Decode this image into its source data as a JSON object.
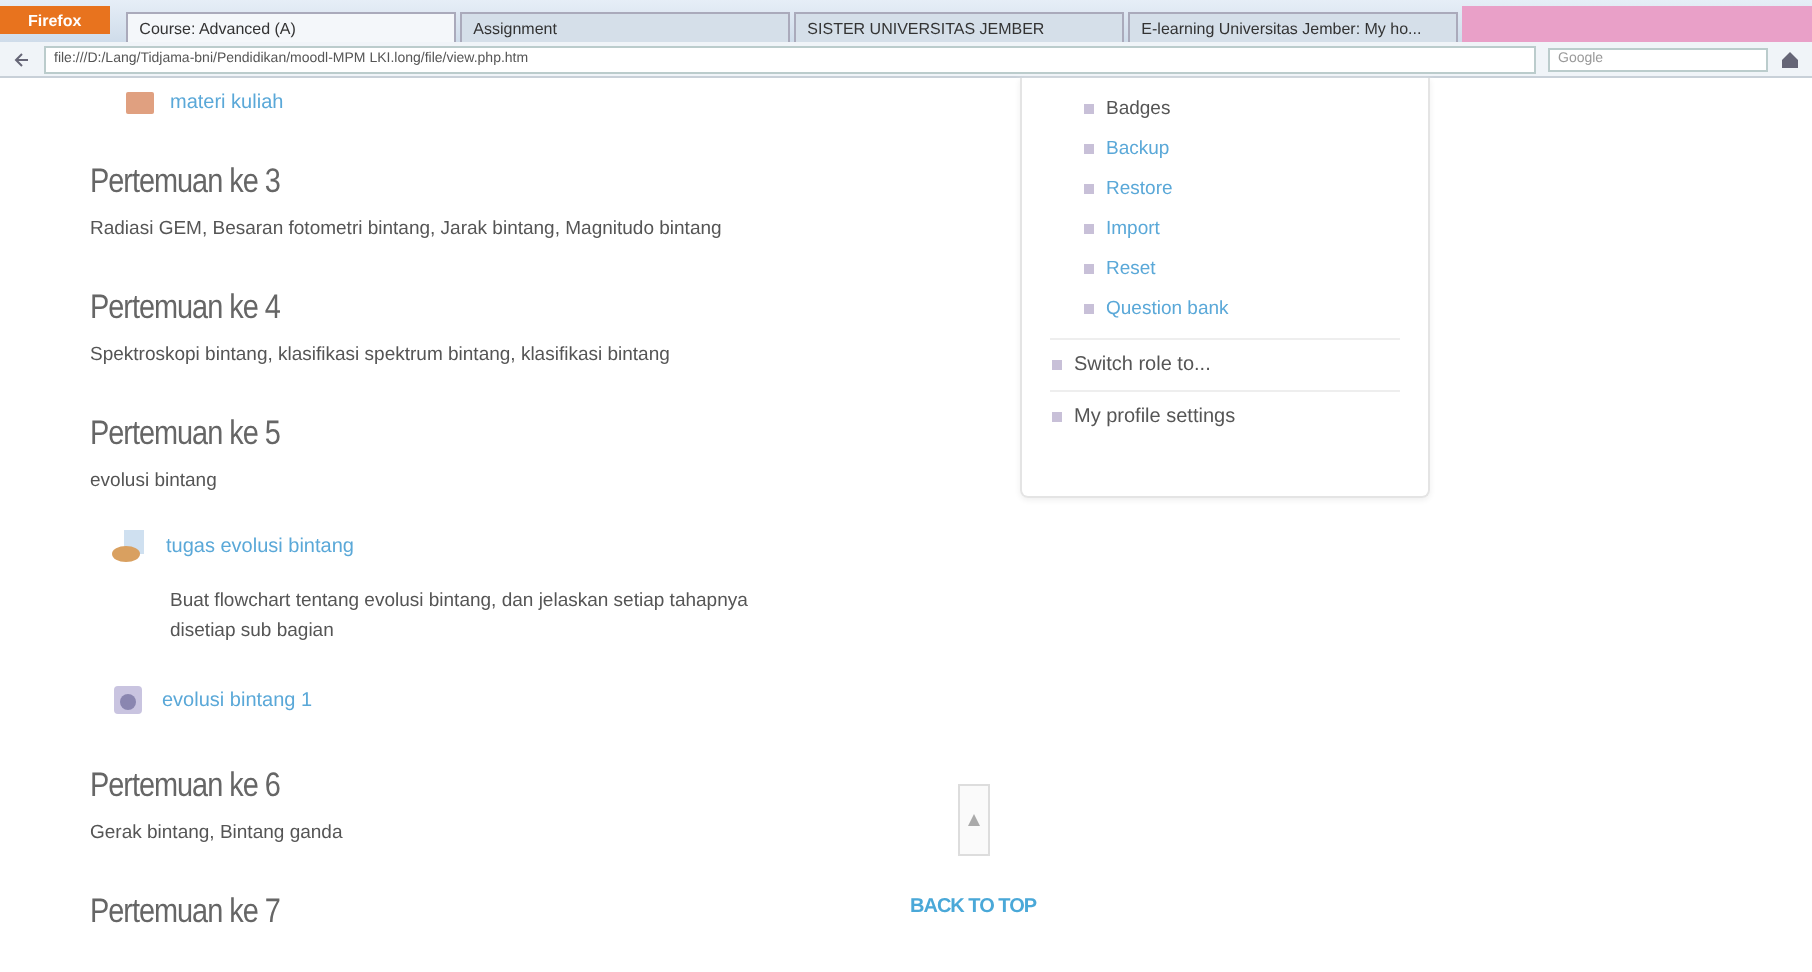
{
  "browser": {
    "menu_button": "Firefox",
    "tabs": [
      {
        "label": "Course: Advanced (A)",
        "selected": true
      },
      {
        "label": "Assignment",
        "selected": false
      },
      {
        "label": "SISTER UNIVERSITAS JEMBER",
        "selected": false
      },
      {
        "label": "E-learning Universitas Jember: My ho...",
        "selected": false
      }
    ],
    "address": "file:///D:/Lang/Tidjama-bni/Pendidikan/moodl-MPM LKI.long/file/view.php.htm",
    "search_placeholder": "Google"
  },
  "course": {
    "top_link": "materi kuliah",
    "sections": [
      {
        "title": "Pertemuan ke 3",
        "summary": "Radiasi GEM, Besaran fotometri bintang, Jarak bintang, Magnitudo bintang"
      },
      {
        "title": "Pertemuan ke 4",
        "summary": "Spektroskopi bintang, klasifikasi spektrum bintang, klasifikasi bintang"
      },
      {
        "title": "Pertemuan ke 5",
        "summary": "evolusi bintang",
        "activities": [
          {
            "kind": "assignment",
            "label": "tugas evolusi bintang",
            "description": "Buat flowchart tentang evolusi bintang, dan jelaskan setiap tahapnya disetiap sub bagian"
          },
          {
            "kind": "quiz",
            "label": "evolusi bintang 1"
          }
        ]
      },
      {
        "title": "Pertemuan ke 6",
        "summary": "Gerak bintang, Bintang ganda"
      },
      {
        "title": "Pertemuan ke 7"
      }
    ]
  },
  "admin_menu": {
    "sub_items": [
      {
        "label": "Badges",
        "link": false
      },
      {
        "label": "Backup",
        "link": true
      },
      {
        "label": "Restore",
        "link": true
      },
      {
        "label": "Import",
        "link": true
      },
      {
        "label": "Reset",
        "link": true
      },
      {
        "label": "Question bank",
        "link": true
      }
    ],
    "items": [
      "Switch role to...",
      "My profile settings"
    ]
  },
  "back_to_top": "BACK TO TOP"
}
